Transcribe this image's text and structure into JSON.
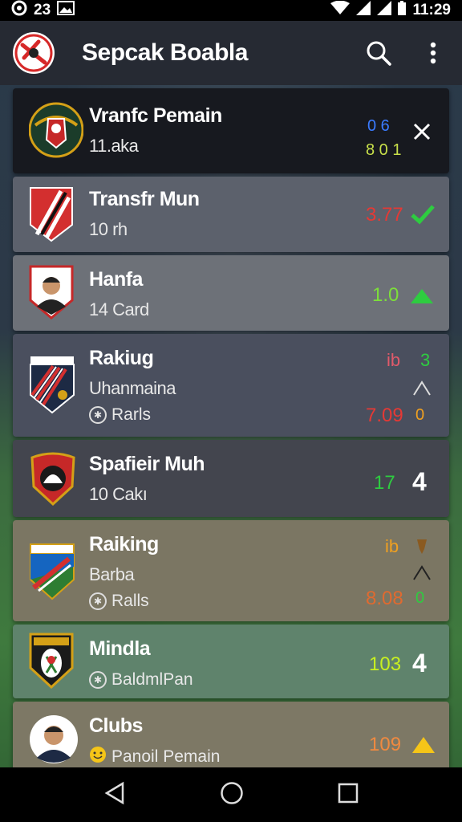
{
  "status": {
    "left_num": "23",
    "time": "11:29"
  },
  "app": {
    "title": "Sepcak Boabla"
  },
  "cards": [
    {
      "title": "Vranfc Pemain",
      "sub": "11.aka",
      "val_top": "0 6",
      "val_bottom": "8 0 1",
      "icon": "close-icon"
    },
    {
      "title": "Transfr Mun",
      "sub": "10 rh",
      "val": "3.77",
      "icon": "check-icon"
    },
    {
      "title": "Hanfa",
      "sub": "14 Card",
      "val": "1.0",
      "icon": "triangle-up-icon"
    },
    {
      "title": "Rakiug",
      "sub": "Uhanmaina",
      "sub2": "Rarls",
      "val_top": "ib",
      "val_top2": "3",
      "val_bottom": "7.09",
      "val_bottom2": "0"
    },
    {
      "title": "Spafieir Muh",
      "sub": "10 Cakı",
      "val": "17",
      "val2": "4"
    },
    {
      "title": "Raiking",
      "sub": "Barba",
      "sub2": "Ralls",
      "val_top": "ib",
      "val_bottom": "8.08",
      "val_bottom2": "0"
    },
    {
      "title": "Mindla",
      "sub": "BaldmlPan",
      "val": "103",
      "val2": "4"
    },
    {
      "title": "Clubs",
      "sub": "Panoil Pemain",
      "val": "109",
      "icon": "warning-triangle-icon"
    }
  ]
}
